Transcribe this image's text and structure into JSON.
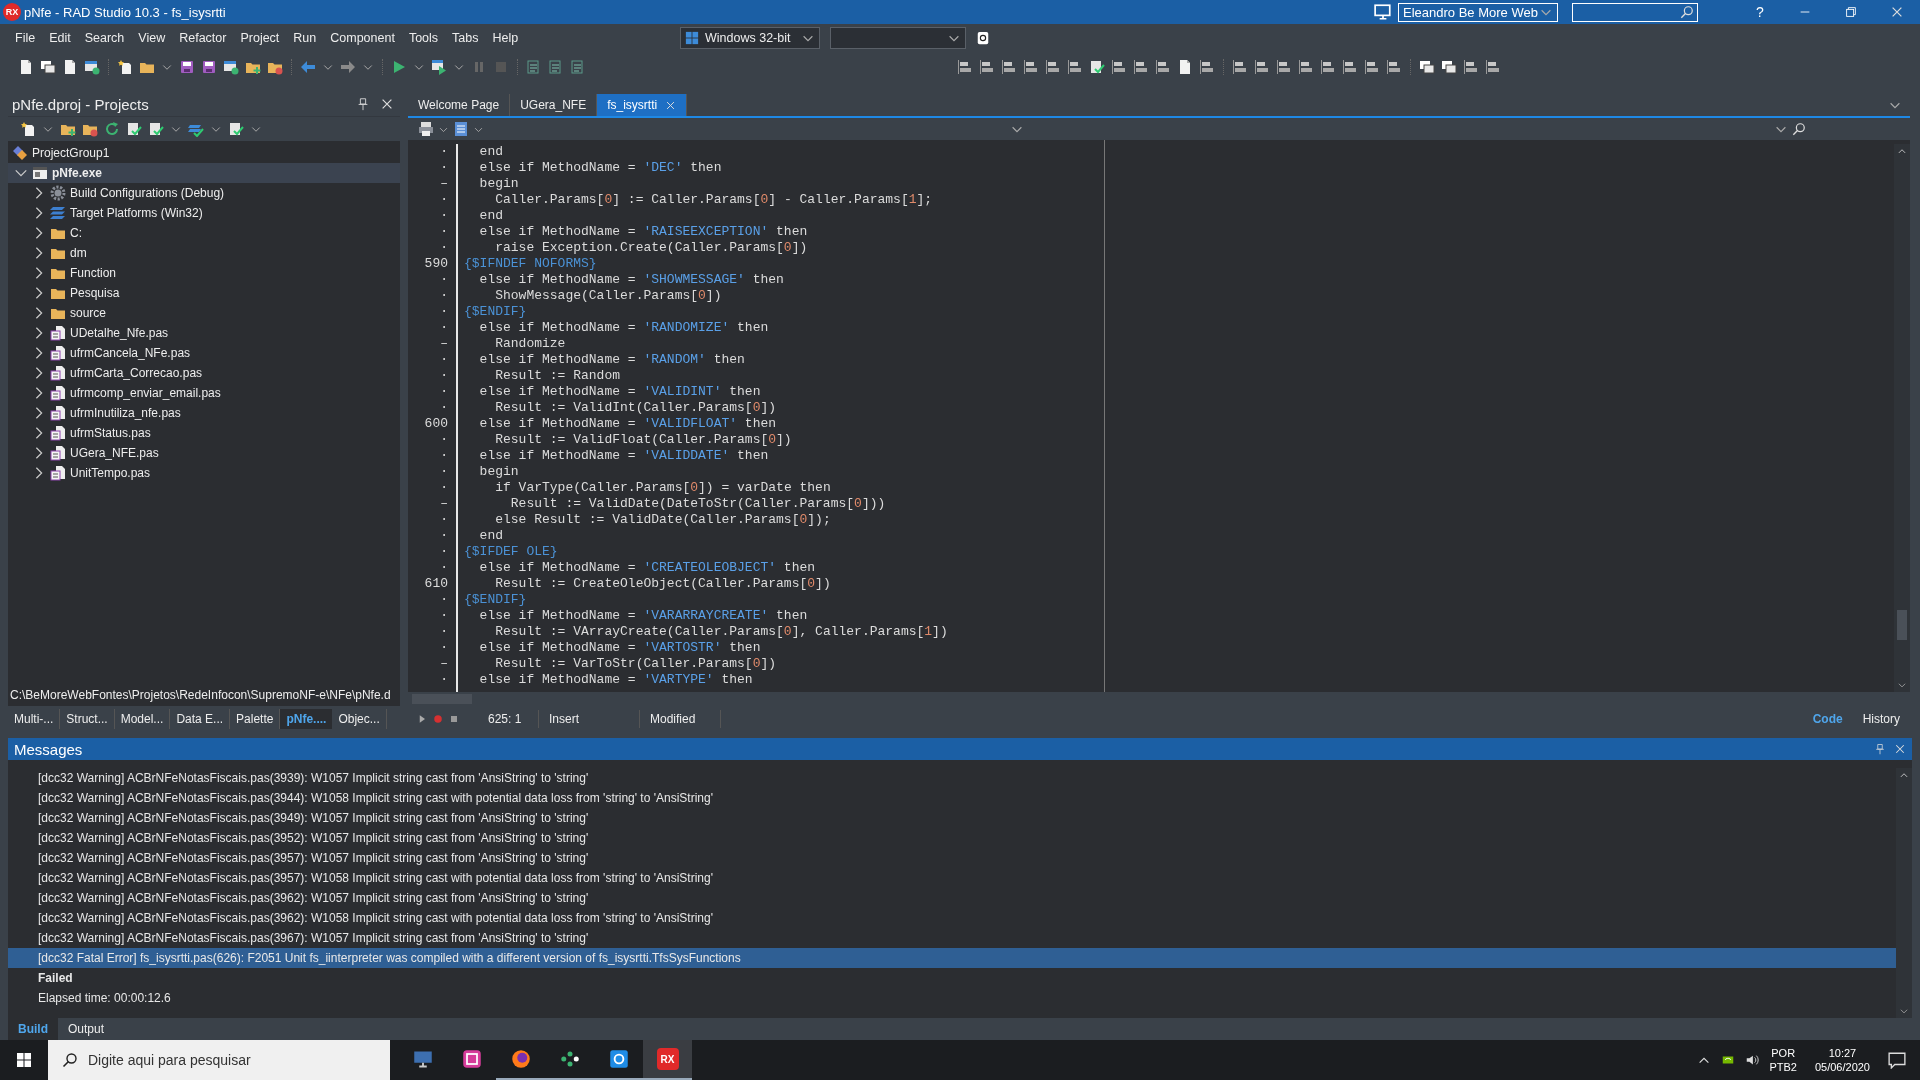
{
  "window": {
    "logo": "RX",
    "title": "pNfe - RAD Studio 10.3 - fs_isysrtti",
    "layout": "Eleandro Be More Web",
    "help": "?"
  },
  "menu": [
    "File",
    "Edit",
    "Search",
    "View",
    "Refactor",
    "Project",
    "Run",
    "Component",
    "Tools",
    "Tabs",
    "Help"
  ],
  "platform": {
    "value": "Windows 32-bit"
  },
  "projects_panel": {
    "title": "pNfe.dproj - Projects",
    "tree": [
      {
        "label": "ProjectGroup1",
        "kind": "group",
        "selected": false,
        "children": [
          {
            "label": "pNfe.exe",
            "kind": "project",
            "expanded": true,
            "selected": true,
            "children": [
              {
                "label": "Build Configurations (Debug)",
                "kind": "config",
                "expanded": false,
                "selected": false
              },
              {
                "label": "Target Platforms (Win32)",
                "kind": "platform",
                "expanded": false,
                "selected": false
              },
              {
                "label": "C:",
                "kind": "folder",
                "expanded": false,
                "selected": false
              },
              {
                "label": "dm",
                "kind": "folder",
                "expanded": false,
                "selected": false
              },
              {
                "label": "Function",
                "kind": "folder",
                "expanded": false,
                "selected": false
              },
              {
                "label": "Pesquisa",
                "kind": "folder",
                "expanded": false,
                "selected": false
              },
              {
                "label": "source",
                "kind": "folder",
                "expanded": false,
                "selected": false
              },
              {
                "label": "UDetalhe_Nfe.pas",
                "kind": "unit",
                "expanded": false,
                "selected": false
              },
              {
                "label": "ufrmCancela_NFe.pas",
                "kind": "unit",
                "expanded": false,
                "selected": false
              },
              {
                "label": "ufrmCarta_Correcao.pas",
                "kind": "unit",
                "expanded": false,
                "selected": false
              },
              {
                "label": "ufrmcomp_enviar_email.pas",
                "kind": "unit",
                "expanded": false,
                "selected": false
              },
              {
                "label": "ufrmInutiliza_nfe.pas",
                "kind": "unit",
                "expanded": false,
                "selected": false
              },
              {
                "label": "ufrmStatus.pas",
                "kind": "unit",
                "expanded": false,
                "selected": false
              },
              {
                "label": "UGera_NFE.pas",
                "kind": "unit",
                "expanded": false,
                "selected": false
              },
              {
                "label": "UnitTempo.pas",
                "kind": "unit",
                "expanded": false,
                "selected": false
              }
            ]
          }
        ]
      }
    ],
    "path": "C:\\BeMoreWebFontes\\Projetos\\RedeInfocon\\SupremoNF-e\\NFe\\pNfe.d",
    "tabs": [
      {
        "label": "Multi-...",
        "selected": false
      },
      {
        "label": "Struct...",
        "selected": false
      },
      {
        "label": "Model...",
        "selected": false
      },
      {
        "label": "Data E...",
        "selected": false
      },
      {
        "label": "Palette",
        "selected": false
      },
      {
        "label": "pNfe....",
        "selected": true
      },
      {
        "label": "Objec...",
        "selected": false
      }
    ]
  },
  "editor": {
    "tabs": [
      {
        "label": "Welcome Page",
        "selected": false
      },
      {
        "label": "UGera_NFE",
        "selected": false
      },
      {
        "label": "fs_isysrtti",
        "selected": true
      }
    ],
    "lines": [
      {
        "gutter": "·",
        "parts": [
          {
            "kind": "code",
            "text": "  end"
          }
        ]
      },
      {
        "gutter": "·",
        "parts": [
          {
            "kind": "code",
            "text": "  else if MethodName = "
          },
          {
            "kind": "string",
            "text": "'DEC'"
          },
          {
            "kind": "code",
            "text": " then"
          }
        ]
      },
      {
        "gutter": "–",
        "parts": [
          {
            "kind": "code",
            "text": "  begin"
          }
        ]
      },
      {
        "gutter": "·",
        "parts": [
          {
            "kind": "code",
            "text": "    Caller.Params["
          },
          {
            "kind": "number",
            "text": "0"
          },
          {
            "kind": "code",
            "text": "] := Caller.Params["
          },
          {
            "kind": "number",
            "text": "0"
          },
          {
            "kind": "code",
            "text": "] - Caller.Params["
          },
          {
            "kind": "number",
            "text": "1"
          },
          {
            "kind": "code",
            "text": "];"
          }
        ]
      },
      {
        "gutter": "·",
        "parts": [
          {
            "kind": "code",
            "text": "  end"
          }
        ]
      },
      {
        "gutter": "·",
        "parts": [
          {
            "kind": "code",
            "text": "  else if MethodName = "
          },
          {
            "kind": "string",
            "text": "'RAISEEXCEPTION'"
          },
          {
            "kind": "code",
            "text": " then"
          }
        ]
      },
      {
        "gutter": "·",
        "parts": [
          {
            "kind": "code",
            "text": "    raise Exception.Create(Caller.Params["
          },
          {
            "kind": "number",
            "text": "0"
          },
          {
            "kind": "code",
            "text": "])"
          }
        ]
      },
      {
        "gutter": "590",
        "parts": [
          {
            "kind": "directive",
            "text": "{$IFNDEF NOFORMS}"
          }
        ]
      },
      {
        "gutter": "·",
        "parts": [
          {
            "kind": "code",
            "text": "  else if MethodName = "
          },
          {
            "kind": "string",
            "text": "'SHOWMESSAGE'"
          },
          {
            "kind": "code",
            "text": " then"
          }
        ]
      },
      {
        "gutter": "·",
        "parts": [
          {
            "kind": "code",
            "text": "    ShowMessage(Caller.Params["
          },
          {
            "kind": "number",
            "text": "0"
          },
          {
            "kind": "code",
            "text": "])"
          }
        ]
      },
      {
        "gutter": "·",
        "parts": [
          {
            "kind": "directive",
            "text": "{$ENDIF}"
          }
        ]
      },
      {
        "gutter": "·",
        "parts": [
          {
            "kind": "code",
            "text": "  else if MethodName = "
          },
          {
            "kind": "string",
            "text": "'RANDOMIZE'"
          },
          {
            "kind": "code",
            "text": " then"
          }
        ]
      },
      {
        "gutter": "–",
        "parts": [
          {
            "kind": "code",
            "text": "    Randomize"
          }
        ]
      },
      {
        "gutter": "·",
        "parts": [
          {
            "kind": "code",
            "text": "  else if MethodName = "
          },
          {
            "kind": "string",
            "text": "'RANDOM'"
          },
          {
            "kind": "code",
            "text": " then"
          }
        ]
      },
      {
        "gutter": "·",
        "parts": [
          {
            "kind": "code",
            "text": "    Result := Random"
          }
        ]
      },
      {
        "gutter": "·",
        "parts": [
          {
            "kind": "code",
            "text": "  else if MethodName = "
          },
          {
            "kind": "string",
            "text": "'VALIDINT'"
          },
          {
            "kind": "code",
            "text": " then"
          }
        ]
      },
      {
        "gutter": "·",
        "parts": [
          {
            "kind": "code",
            "text": "    Result := ValidInt(Caller.Params["
          },
          {
            "kind": "number",
            "text": "0"
          },
          {
            "kind": "code",
            "text": "])"
          }
        ]
      },
      {
        "gutter": "600",
        "parts": [
          {
            "kind": "code",
            "text": "  else if MethodName = "
          },
          {
            "kind": "string",
            "text": "'VALIDFLOAT'"
          },
          {
            "kind": "code",
            "text": " then"
          }
        ]
      },
      {
        "gutter": "·",
        "parts": [
          {
            "kind": "code",
            "text": "    Result := ValidFloat(Caller.Params["
          },
          {
            "kind": "number",
            "text": "0"
          },
          {
            "kind": "code",
            "text": "])"
          }
        ]
      },
      {
        "gutter": "·",
        "parts": [
          {
            "kind": "code",
            "text": "  else if MethodName = "
          },
          {
            "kind": "string",
            "text": "'VALIDDATE'"
          },
          {
            "kind": "code",
            "text": " then"
          }
        ]
      },
      {
        "gutter": "·",
        "parts": [
          {
            "kind": "code",
            "text": "  begin"
          }
        ]
      },
      {
        "gutter": "·",
        "parts": [
          {
            "kind": "code",
            "text": "    if VarType(Caller.Params["
          },
          {
            "kind": "number",
            "text": "0"
          },
          {
            "kind": "code",
            "text": "]) = varDate then"
          }
        ]
      },
      {
        "gutter": "–",
        "parts": [
          {
            "kind": "code",
            "text": "      Result := ValidDate(DateToStr(Caller.Params["
          },
          {
            "kind": "number",
            "text": "0"
          },
          {
            "kind": "code",
            "text": "]))"
          }
        ]
      },
      {
        "gutter": "·",
        "parts": [
          {
            "kind": "code",
            "text": "    else Result := ValidDate(Caller.Params["
          },
          {
            "kind": "number",
            "text": "0"
          },
          {
            "kind": "code",
            "text": "]);"
          }
        ]
      },
      {
        "gutter": "·",
        "parts": [
          {
            "kind": "code",
            "text": "  end"
          }
        ]
      },
      {
        "gutter": "·",
        "parts": [
          {
            "kind": "directive",
            "text": "{$IFDEF OLE}"
          }
        ]
      },
      {
        "gutter": "·",
        "parts": [
          {
            "kind": "code",
            "text": "  else if MethodName = "
          },
          {
            "kind": "string",
            "text": "'CREATEOLEOBJECT'"
          },
          {
            "kind": "code",
            "text": " then"
          }
        ]
      },
      {
        "gutter": "610",
        "parts": [
          {
            "kind": "code",
            "text": "    Result := CreateOleObject(Caller.Params["
          },
          {
            "kind": "number",
            "text": "0"
          },
          {
            "kind": "code",
            "text": "])"
          }
        ]
      },
      {
        "gutter": "·",
        "parts": [
          {
            "kind": "directive",
            "text": "{$ENDIF}"
          }
        ]
      },
      {
        "gutter": "·",
        "parts": [
          {
            "kind": "code",
            "text": "  else if MethodName = "
          },
          {
            "kind": "string",
            "text": "'VARARRAYCREATE'"
          },
          {
            "kind": "code",
            "text": " then"
          }
        ]
      },
      {
        "gutter": "·",
        "parts": [
          {
            "kind": "code",
            "text": "    Result := VArrayCreate(Caller.Params["
          },
          {
            "kind": "number",
            "text": "0"
          },
          {
            "kind": "code",
            "text": "], Caller.Params["
          },
          {
            "kind": "number",
            "text": "1"
          },
          {
            "kind": "code",
            "text": "])"
          }
        ]
      },
      {
        "gutter": "·",
        "parts": [
          {
            "kind": "code",
            "text": "  else if MethodName = "
          },
          {
            "kind": "string",
            "text": "'VARTOSTR'"
          },
          {
            "kind": "code",
            "text": " then"
          }
        ]
      },
      {
        "gutter": "–",
        "parts": [
          {
            "kind": "code",
            "text": "    Result := VarToStr(Caller.Params["
          },
          {
            "kind": "number",
            "text": "0"
          },
          {
            "kind": "code",
            "text": "])"
          }
        ]
      },
      {
        "gutter": "·",
        "parts": [
          {
            "kind": "code",
            "text": "  else if MethodName = "
          },
          {
            "kind": "string",
            "text": "'VARTYPE'"
          },
          {
            "kind": "code",
            "text": " then"
          }
        ]
      }
    ],
    "status": {
      "position": "625:  1",
      "mode": "Insert",
      "state": "Modified"
    },
    "view_tabs": [
      {
        "label": "Code",
        "selected": true
      },
      {
        "label": "History",
        "selected": false
      }
    ]
  },
  "messages": {
    "title": "Messages",
    "rows": [
      {
        "kind": "warning",
        "selected": false,
        "text": "[dcc32 Warning] ACBrNFeNotasFiscais.pas(3939): W1057 Implicit string cast from 'AnsiString' to 'string'"
      },
      {
        "kind": "warning",
        "selected": false,
        "text": "[dcc32 Warning] ACBrNFeNotasFiscais.pas(3944): W1058 Implicit string cast with potential data loss from 'string' to 'AnsiString'"
      },
      {
        "kind": "warning",
        "selected": false,
        "text": "[dcc32 Warning] ACBrNFeNotasFiscais.pas(3949): W1057 Implicit string cast from 'AnsiString' to 'string'"
      },
      {
        "kind": "warning",
        "selected": false,
        "text": "[dcc32 Warning] ACBrNFeNotasFiscais.pas(3952): W1057 Implicit string cast from 'AnsiString' to 'string'"
      },
      {
        "kind": "warning",
        "selected": false,
        "text": "[dcc32 Warning] ACBrNFeNotasFiscais.pas(3957): W1057 Implicit string cast from 'AnsiString' to 'string'"
      },
      {
        "kind": "warning",
        "selected": false,
        "text": "[dcc32 Warning] ACBrNFeNotasFiscais.pas(3957): W1058 Implicit string cast with potential data loss from 'string' to 'AnsiString'"
      },
      {
        "kind": "warning",
        "selected": false,
        "text": "[dcc32 Warning] ACBrNFeNotasFiscais.pas(3962): W1057 Implicit string cast from 'AnsiString' to 'string'"
      },
      {
        "kind": "warning",
        "selected": false,
        "text": "[dcc32 Warning] ACBrNFeNotasFiscais.pas(3962): W1058 Implicit string cast with potential data loss from 'string' to 'AnsiString'"
      },
      {
        "kind": "warning",
        "selected": false,
        "text": "[dcc32 Warning] ACBrNFeNotasFiscais.pas(3967): W1057 Implicit string cast from 'AnsiString' to 'string'"
      },
      {
        "kind": "fatal",
        "selected": true,
        "text": "[dcc32 Fatal Error] fs_isysrtti.pas(626): F2051 Unit fs_iinterpreter was compiled with a different version of fs_isysrtti.TfsSysFunctions"
      },
      {
        "kind": "result",
        "selected": false,
        "text": "Failed"
      },
      {
        "kind": "info",
        "selected": false,
        "text": "Elapsed time: 00:00:12.6"
      }
    ],
    "tabs": [
      {
        "label": "Build",
        "selected": true
      },
      {
        "label": "Output",
        "selected": false
      }
    ]
  },
  "taskbar": {
    "search": {
      "placeholder": "Digite aqui para pesquisar"
    },
    "apps": [
      {
        "kind": "monitor",
        "running": false,
        "selected": false
      },
      {
        "kind": "square",
        "running": false,
        "selected": false
      },
      {
        "kind": "globe",
        "running": true,
        "selected": false
      },
      {
        "kind": "dots",
        "running": true,
        "selected": false
      },
      {
        "kind": "camera",
        "running": true,
        "selected": false
      },
      {
        "kind": "logo",
        "label": "RX",
        "running": true,
        "selected": true
      }
    ],
    "language": "POR",
    "keyboard": "PTB2",
    "time": "10:27",
    "date": "05/06/2020"
  }
}
